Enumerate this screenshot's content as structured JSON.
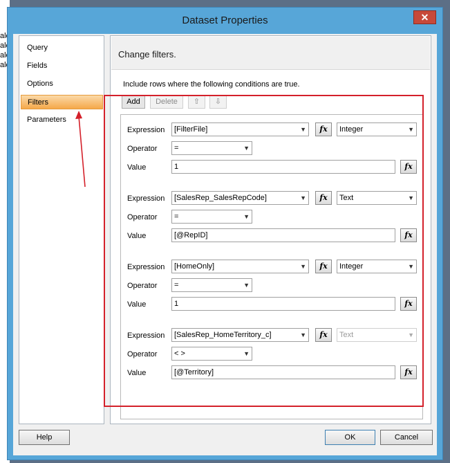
{
  "background_fragment": [
    "ale",
    "ale",
    "ale",
    "ale"
  ],
  "window": {
    "title": "Dataset Properties",
    "close_glyph": "✕"
  },
  "nav": {
    "items": [
      {
        "label": "Query",
        "selected": false
      },
      {
        "label": "Fields",
        "selected": false
      },
      {
        "label": "Options",
        "selected": false
      },
      {
        "label": "Filters",
        "selected": true
      },
      {
        "label": "Parameters",
        "selected": false
      }
    ]
  },
  "content": {
    "header": "Change filters.",
    "subtext": "Include rows where the following conditions are true.",
    "toolbar": {
      "add": "Add",
      "delete": "Delete",
      "up_glyph": "⇧",
      "down_glyph": "⇩"
    },
    "labels": {
      "expression": "Expression",
      "operator": "Operator",
      "value": "Value",
      "fx": "fx"
    },
    "filters": [
      {
        "expression": "[FilterFile]",
        "type": "Integer",
        "operator": "=",
        "value": "1",
        "type_disabled": false
      },
      {
        "expression": "[SalesRep_SalesRepCode]",
        "type": "Text",
        "operator": "=",
        "value": "[@RepID]",
        "type_disabled": false
      },
      {
        "expression": "[HomeOnly]",
        "type": "Integer",
        "operator": "=",
        "value": "1",
        "type_disabled": false
      },
      {
        "expression": "[SalesRep_HomeTerritory_c]",
        "type": "Text",
        "operator": "< >",
        "value": "[@Territory]",
        "type_disabled": true
      }
    ]
  },
  "footer": {
    "help": "Help",
    "ok": "OK",
    "cancel": "Cancel"
  },
  "colors": {
    "highlight": "#d4202a",
    "titlebar": "#57a6d8",
    "selected": "#f5a84a"
  }
}
